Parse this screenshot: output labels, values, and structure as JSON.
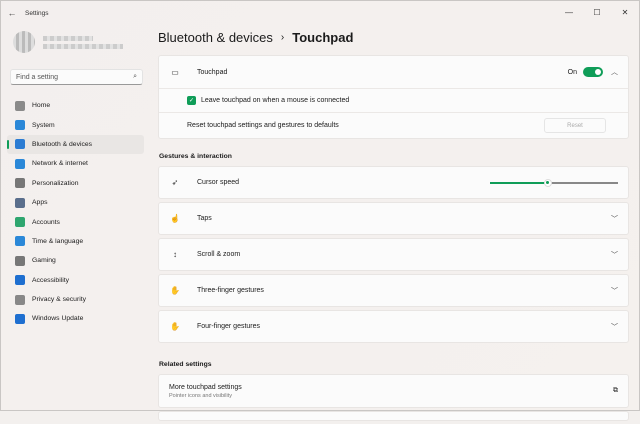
{
  "window": {
    "title": "Settings",
    "minimize": "—",
    "maximize": "☐",
    "close": "✕"
  },
  "search": {
    "placeholder": "Find a setting"
  },
  "nav": [
    {
      "label": "Home",
      "color": "#8a8a8a"
    },
    {
      "label": "System",
      "color": "#2b88d8"
    },
    {
      "label": "Bluetooth & devices",
      "color": "#2b7cd3",
      "active": true
    },
    {
      "label": "Network & internet",
      "color": "#2b88d8"
    },
    {
      "label": "Personalization",
      "color": "#777"
    },
    {
      "label": "Apps",
      "color": "#5a6e8c"
    },
    {
      "label": "Accounts",
      "color": "#2ea66f"
    },
    {
      "label": "Time & language",
      "color": "#2b88d8"
    },
    {
      "label": "Gaming",
      "color": "#777"
    },
    {
      "label": "Accessibility",
      "color": "#1e6fd0"
    },
    {
      "label": "Privacy & security",
      "color": "#888"
    },
    {
      "label": "Windows Update",
      "color": "#1e6fd0"
    }
  ],
  "breadcrumb": {
    "parent": "Bluetooth & devices",
    "sep": "›",
    "current": "Touchpad"
  },
  "touchpad": {
    "label": "Touchpad",
    "state": "On",
    "leave_on": "Leave touchpad on when a mouse is connected",
    "reset_text": "Reset touchpad settings and gestures to defaults",
    "reset_button": "Reset"
  },
  "gestures": {
    "heading": "Gestures & interaction",
    "cursor_speed": "Cursor speed",
    "cursor_speed_value": 0.45,
    "items": [
      "Taps",
      "Scroll & zoom",
      "Three-finger gestures",
      "Four-finger gestures"
    ]
  },
  "related": {
    "heading": "Related settings",
    "title": "More touchpad settings",
    "subtitle": "Pointer icons and visibility"
  }
}
